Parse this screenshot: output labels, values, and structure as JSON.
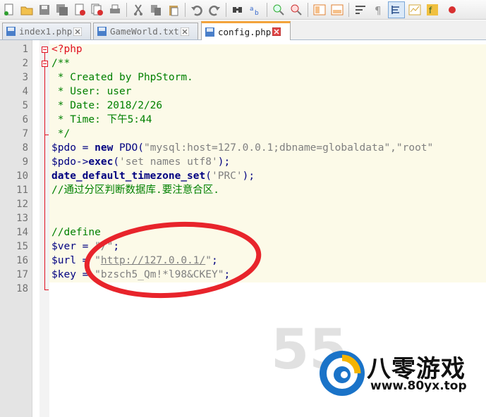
{
  "toolbar": {
    "icons": [
      "new-file-icon",
      "open-file-icon",
      "save-icon",
      "save-all-icon",
      "close-icon",
      "close-all-icon",
      "print-icon",
      "cut-icon",
      "copy-icon",
      "paste-icon",
      "undo-icon",
      "redo-icon",
      "find-icon",
      "replace-icon",
      "zoom-in-icon",
      "zoom-out-icon",
      "sync-vertical-icon",
      "sync-horizontal-icon",
      "word-wrap-icon",
      "show-all-chars-icon",
      "indent-guide-icon",
      "doc-map-icon",
      "function-list-icon",
      "macro-icon"
    ]
  },
  "tabs": [
    {
      "label": "index1.php",
      "active": false
    },
    {
      "label": "GameWorld.txt",
      "active": false
    },
    {
      "label": "config.php",
      "active": true
    }
  ],
  "line_numbers": [
    "1",
    "2",
    "3",
    "4",
    "5",
    "6",
    "7",
    "8",
    "9",
    "10",
    "11",
    "12",
    "13",
    "14",
    "15",
    "16",
    "17",
    "18"
  ],
  "code": {
    "l1": "<?php",
    "l2": "/**",
    "l3": " * Created by PhpStorm.",
    "l4": " * User: user",
    "l5": " * Date: 2018/2/26",
    "l6": " * Time: 下午5:44",
    "l7": " */",
    "l8_var": "$pdo",
    "l8_op": " = ",
    "l8_kw": "new",
    "l8_cls": " PDO(",
    "l8_str": "\"mysql:host=127.0.0.1;dbname=globaldata\",\"root\"",
    "l9_var": "$pdo",
    "l9_op": "->",
    "l9_kw": "exec",
    "l9_open": "(",
    "l9_str": "'set names utf8'",
    "l9_close": ");",
    "l10_kw": "date_default_timezone_set",
    "l10_open": "(",
    "l10_str": "'PRC'",
    "l10_close": ");",
    "l11": "//通过分区判断数据库.要注意合区.",
    "l14": "//define",
    "l15_var": "$ver",
    "l15_op": " = ",
    "l15_str": "\"/\"",
    "l15_end": ";",
    "l16_var": "$url",
    "l16_op": " = ",
    "l16_q1": "\"",
    "l16_url": "http://127.0.0.1/",
    "l16_q2": "\"",
    "l16_end": ";",
    "l17_var": "$key",
    "l17_op": " = ",
    "l17_str": "\"bzsch5_Qm!*l98&CKEY\"",
    "l17_end": ";"
  },
  "watermark": {
    "brand": "八零游戏",
    "url": "www.80yx.top",
    "faded": "55"
  },
  "colors": {
    "php_tag": "#e01020",
    "comment": "#008000",
    "string": "#808080",
    "keyword": "#000080",
    "annotation": "#e8242b",
    "active_tab_accent": "#f3a43b"
  }
}
